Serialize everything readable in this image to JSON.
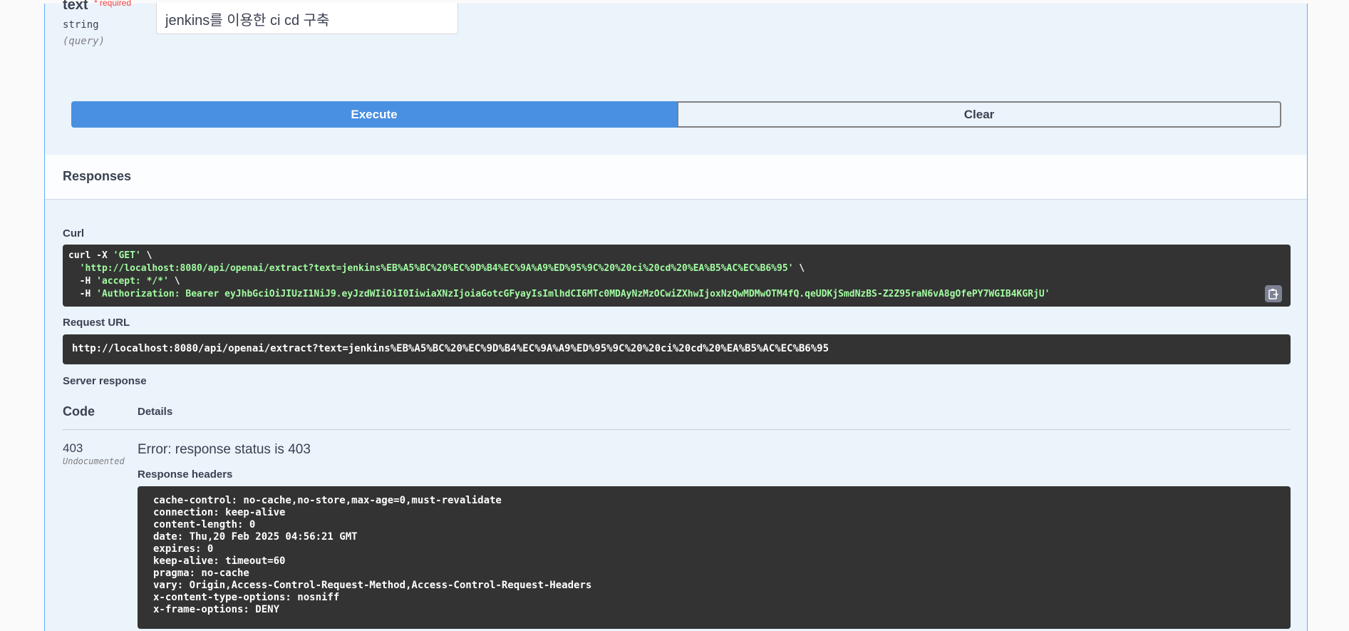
{
  "param": {
    "name": "text",
    "required_label": "* required",
    "type": "string",
    "in": "(query)",
    "value": "jenkins를 이용한  ci cd 구축"
  },
  "buttons": {
    "execute": "Execute",
    "clear": "Clear"
  },
  "responses": {
    "title": "Responses"
  },
  "curl": {
    "label": "Curl",
    "cmd": "curl -X ",
    "method": "'GET'",
    "cont": " \\",
    "url": "'http://localhost:8080/api/openai/extract?text=jenkins%EB%A5%BC%20%EC%9D%B4%EC%9A%A9%ED%95%9C%20%20ci%20cd%20%EA%B5%AC%EC%B6%95'",
    "h1_flag": "  -H ",
    "h1": "'accept: */*'",
    "h2_flag": "  -H ",
    "h2": "'Authorization: Bearer eyJhbGciOiJIUzI1NiJ9.eyJzdWIiOiI0IiwiaXNzIjoiaGotcGFyayIsImlhdCI6MTc0MDAyNzMzOCwiZXhwIjoxNzQwMDMwOTM4fQ.qeUDKjSmdNzBS-Z2Z95raN6vA8gOfePY7WGIB4KGRjU'"
  },
  "request_url": {
    "label": "Request URL",
    "value": "http://localhost:8080/api/openai/extract?text=jenkins%EB%A5%BC%20%EC%9D%B4%EC%9A%A9%ED%95%9C%20%20ci%20cd%20%EA%B5%AC%EC%B6%95"
  },
  "server_response": {
    "label": "Server response",
    "col_code": "Code",
    "col_details": "Details",
    "code": "403",
    "undocumented": "Undocumented",
    "error": "Error: response status is 403",
    "headers_label": "Response headers",
    "headers": [
      "cache-control: no-cache,no-store,max-age=0,must-revalidate",
      "connection: keep-alive",
      "content-length: 0",
      "date: Thu,20 Feb 2025 04:56:21 GMT",
      "expires: 0",
      "keep-alive: timeout=60",
      "pragma: no-cache",
      "vary: Origin,Access-Control-Request-Method,Access-Control-Request-Headers",
      "x-content-type-options: nosniff",
      "x-frame-options: DENY"
    ]
  },
  "icons": {
    "copy": "clipboard-icon"
  },
  "colors": {
    "execute": "#4990e2",
    "panel": "#ebf3fb",
    "code_bg": "#333333",
    "string": "#a2fca2",
    "required": "#f93e3e"
  }
}
